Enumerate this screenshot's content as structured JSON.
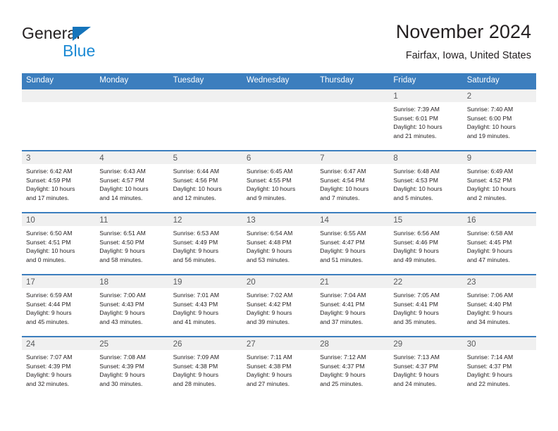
{
  "brand": {
    "name_part1": "General",
    "name_part2": "Blue",
    "logo_icon": "triangle-flag-icon"
  },
  "header": {
    "title": "November 2024",
    "subtitle": "Fairfax, Iowa, United States"
  },
  "colors": {
    "header_blue": "#3c7ebe",
    "brand_blue": "#1c8ad4",
    "logo_blue": "#1574bb",
    "band_gray": "#f0f0f0",
    "text": "#231f20"
  },
  "weekday_headers": [
    "Sunday",
    "Monday",
    "Tuesday",
    "Wednesday",
    "Thursday",
    "Friday",
    "Saturday"
  ],
  "weeks": [
    [
      {
        "empty": true
      },
      {
        "empty": true
      },
      {
        "empty": true
      },
      {
        "empty": true
      },
      {
        "empty": true
      },
      {
        "day": "1",
        "sunrise": "Sunrise: 7:39 AM",
        "sunset": "Sunset: 6:01 PM",
        "daylight_1": "Daylight: 10 hours",
        "daylight_2": "and 21 minutes."
      },
      {
        "day": "2",
        "sunrise": "Sunrise: 7:40 AM",
        "sunset": "Sunset: 6:00 PM",
        "daylight_1": "Daylight: 10 hours",
        "daylight_2": "and 19 minutes."
      }
    ],
    [
      {
        "day": "3",
        "sunrise": "Sunrise: 6:42 AM",
        "sunset": "Sunset: 4:59 PM",
        "daylight_1": "Daylight: 10 hours",
        "daylight_2": "and 17 minutes."
      },
      {
        "day": "4",
        "sunrise": "Sunrise: 6:43 AM",
        "sunset": "Sunset: 4:57 PM",
        "daylight_1": "Daylight: 10 hours",
        "daylight_2": "and 14 minutes."
      },
      {
        "day": "5",
        "sunrise": "Sunrise: 6:44 AM",
        "sunset": "Sunset: 4:56 PM",
        "daylight_1": "Daylight: 10 hours",
        "daylight_2": "and 12 minutes."
      },
      {
        "day": "6",
        "sunrise": "Sunrise: 6:45 AM",
        "sunset": "Sunset: 4:55 PM",
        "daylight_1": "Daylight: 10 hours",
        "daylight_2": "and 9 minutes."
      },
      {
        "day": "7",
        "sunrise": "Sunrise: 6:47 AM",
        "sunset": "Sunset: 4:54 PM",
        "daylight_1": "Daylight: 10 hours",
        "daylight_2": "and 7 minutes."
      },
      {
        "day": "8",
        "sunrise": "Sunrise: 6:48 AM",
        "sunset": "Sunset: 4:53 PM",
        "daylight_1": "Daylight: 10 hours",
        "daylight_2": "and 5 minutes."
      },
      {
        "day": "9",
        "sunrise": "Sunrise: 6:49 AM",
        "sunset": "Sunset: 4:52 PM",
        "daylight_1": "Daylight: 10 hours",
        "daylight_2": "and 2 minutes."
      }
    ],
    [
      {
        "day": "10",
        "sunrise": "Sunrise: 6:50 AM",
        "sunset": "Sunset: 4:51 PM",
        "daylight_1": "Daylight: 10 hours",
        "daylight_2": "and 0 minutes."
      },
      {
        "day": "11",
        "sunrise": "Sunrise: 6:51 AM",
        "sunset": "Sunset: 4:50 PM",
        "daylight_1": "Daylight: 9 hours",
        "daylight_2": "and 58 minutes."
      },
      {
        "day": "12",
        "sunrise": "Sunrise: 6:53 AM",
        "sunset": "Sunset: 4:49 PM",
        "daylight_1": "Daylight: 9 hours",
        "daylight_2": "and 56 minutes."
      },
      {
        "day": "13",
        "sunrise": "Sunrise: 6:54 AM",
        "sunset": "Sunset: 4:48 PM",
        "daylight_1": "Daylight: 9 hours",
        "daylight_2": "and 53 minutes."
      },
      {
        "day": "14",
        "sunrise": "Sunrise: 6:55 AM",
        "sunset": "Sunset: 4:47 PM",
        "daylight_1": "Daylight: 9 hours",
        "daylight_2": "and 51 minutes."
      },
      {
        "day": "15",
        "sunrise": "Sunrise: 6:56 AM",
        "sunset": "Sunset: 4:46 PM",
        "daylight_1": "Daylight: 9 hours",
        "daylight_2": "and 49 minutes."
      },
      {
        "day": "16",
        "sunrise": "Sunrise: 6:58 AM",
        "sunset": "Sunset: 4:45 PM",
        "daylight_1": "Daylight: 9 hours",
        "daylight_2": "and 47 minutes."
      }
    ],
    [
      {
        "day": "17",
        "sunrise": "Sunrise: 6:59 AM",
        "sunset": "Sunset: 4:44 PM",
        "daylight_1": "Daylight: 9 hours",
        "daylight_2": "and 45 minutes."
      },
      {
        "day": "18",
        "sunrise": "Sunrise: 7:00 AM",
        "sunset": "Sunset: 4:43 PM",
        "daylight_1": "Daylight: 9 hours",
        "daylight_2": "and 43 minutes."
      },
      {
        "day": "19",
        "sunrise": "Sunrise: 7:01 AM",
        "sunset": "Sunset: 4:43 PM",
        "daylight_1": "Daylight: 9 hours",
        "daylight_2": "and 41 minutes."
      },
      {
        "day": "20",
        "sunrise": "Sunrise: 7:02 AM",
        "sunset": "Sunset: 4:42 PM",
        "daylight_1": "Daylight: 9 hours",
        "daylight_2": "and 39 minutes."
      },
      {
        "day": "21",
        "sunrise": "Sunrise: 7:04 AM",
        "sunset": "Sunset: 4:41 PM",
        "daylight_1": "Daylight: 9 hours",
        "daylight_2": "and 37 minutes."
      },
      {
        "day": "22",
        "sunrise": "Sunrise: 7:05 AM",
        "sunset": "Sunset: 4:41 PM",
        "daylight_1": "Daylight: 9 hours",
        "daylight_2": "and 35 minutes."
      },
      {
        "day": "23",
        "sunrise": "Sunrise: 7:06 AM",
        "sunset": "Sunset: 4:40 PM",
        "daylight_1": "Daylight: 9 hours",
        "daylight_2": "and 34 minutes."
      }
    ],
    [
      {
        "day": "24",
        "sunrise": "Sunrise: 7:07 AM",
        "sunset": "Sunset: 4:39 PM",
        "daylight_1": "Daylight: 9 hours",
        "daylight_2": "and 32 minutes."
      },
      {
        "day": "25",
        "sunrise": "Sunrise: 7:08 AM",
        "sunset": "Sunset: 4:39 PM",
        "daylight_1": "Daylight: 9 hours",
        "daylight_2": "and 30 minutes."
      },
      {
        "day": "26",
        "sunrise": "Sunrise: 7:09 AM",
        "sunset": "Sunset: 4:38 PM",
        "daylight_1": "Daylight: 9 hours",
        "daylight_2": "and 28 minutes."
      },
      {
        "day": "27",
        "sunrise": "Sunrise: 7:11 AM",
        "sunset": "Sunset: 4:38 PM",
        "daylight_1": "Daylight: 9 hours",
        "daylight_2": "and 27 minutes."
      },
      {
        "day": "28",
        "sunrise": "Sunrise: 7:12 AM",
        "sunset": "Sunset: 4:37 PM",
        "daylight_1": "Daylight: 9 hours",
        "daylight_2": "and 25 minutes."
      },
      {
        "day": "29",
        "sunrise": "Sunrise: 7:13 AM",
        "sunset": "Sunset: 4:37 PM",
        "daylight_1": "Daylight: 9 hours",
        "daylight_2": "and 24 minutes."
      },
      {
        "day": "30",
        "sunrise": "Sunrise: 7:14 AM",
        "sunset": "Sunset: 4:37 PM",
        "daylight_1": "Daylight: 9 hours",
        "daylight_2": "and 22 minutes."
      }
    ]
  ]
}
